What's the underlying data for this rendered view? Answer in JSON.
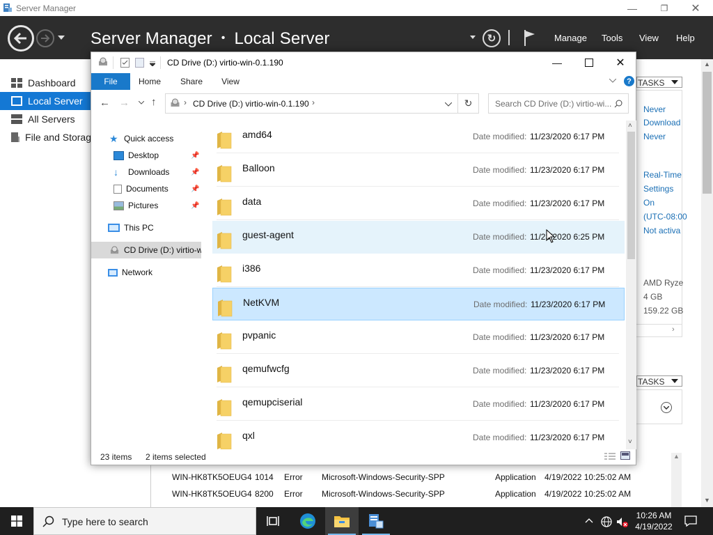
{
  "server_manager": {
    "window_title": "Server Manager",
    "breadcrumb_app": "Server Manager",
    "breadcrumb_sep": "•",
    "breadcrumb_page": "Local Server",
    "menu": {
      "manage": "Manage",
      "tools": "Tools",
      "view": "View",
      "help": "Help"
    },
    "nav": [
      {
        "label": "Dashboard",
        "icon": "dashboard-icon"
      },
      {
        "label": "Local Server",
        "icon": "server-icon",
        "active": true
      },
      {
        "label": "All Servers",
        "icon": "servers-icon"
      },
      {
        "label": "File and Storag",
        "icon": "storage-icon"
      }
    ],
    "tasks_label": "TASKS",
    "properties_right": [
      "Never",
      "Download",
      "Never",
      "Real-Time",
      "Settings",
      "On",
      "(UTC-08:00",
      "Not activa",
      "AMD Ryze",
      "4 GB",
      "159.22 GB"
    ],
    "events": [
      {
        "server": "WIN-HK8TK5OEUG4",
        "id": "1014",
        "severity": "Error",
        "source": "Microsoft-Windows-Security-SPP",
        "log": "Application",
        "date": "4/19/2022 10:25:02 AM"
      },
      {
        "server": "WIN-HK8TK5OEUG4",
        "id": "8200",
        "severity": "Error",
        "source": "Microsoft-Windows-Security-SPP",
        "log": "Application",
        "date": "4/19/2022 10:25:02 AM"
      }
    ]
  },
  "explorer": {
    "title": "CD Drive (D:) virtio-win-0.1.190",
    "ribbon_tabs": {
      "file": "File",
      "home": "Home",
      "share": "Share",
      "view": "View"
    },
    "address": {
      "drive": "CD Drive (D:) virtio-win-0.1.190"
    },
    "search_placeholder": "Search CD Drive (D:) virtio-wi...",
    "nav": {
      "quick_access": "Quick access",
      "desktop": "Desktop",
      "downloads": "Downloads",
      "documents": "Documents",
      "pictures": "Pictures",
      "this_pc": "This PC",
      "cd_drive": "CD Drive (D:) virtio-w",
      "network": "Network"
    },
    "date_label": "Date modified:",
    "folders": [
      {
        "name": "amd64",
        "date": "11/23/2020 6:17 PM"
      },
      {
        "name": "Balloon",
        "date": "11/23/2020 6:17 PM"
      },
      {
        "name": "data",
        "date": "11/23/2020 6:17 PM"
      },
      {
        "name": "guest-agent",
        "date": "11/23/2020 6:25 PM",
        "state": "hover"
      },
      {
        "name": "i386",
        "date": "11/23/2020 6:17 PM"
      },
      {
        "name": "NetKVM",
        "date": "11/23/2020 6:17 PM",
        "state": "selected"
      },
      {
        "name": "pvpanic",
        "date": "11/23/2020 6:17 PM"
      },
      {
        "name": "qemufwcfg",
        "date": "11/23/2020 6:17 PM"
      },
      {
        "name": "qemupciserial",
        "date": "11/23/2020 6:17 PM"
      },
      {
        "name": "qxl",
        "date": "11/23/2020 6:17 PM"
      }
    ],
    "status": {
      "count": "23 items",
      "selected": "2 items selected"
    }
  },
  "taskbar": {
    "search_placeholder": "Type here to search",
    "time": "10:26 AM",
    "date": "4/19/2022"
  },
  "colors": {
    "accent": "#1478d4",
    "header_bg": "#2d2d2d",
    "selection": "#cce8ff",
    "folder": "#f6d166"
  }
}
